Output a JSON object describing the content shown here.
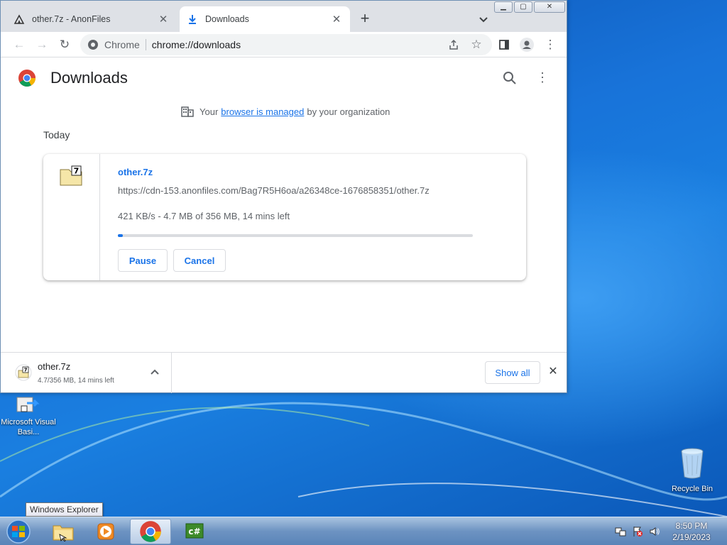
{
  "browser": {
    "tabs": [
      {
        "title": "other.7z - AnonFiles",
        "icon": "anonfiles-icon",
        "active": false
      },
      {
        "title": "Downloads",
        "icon": "download-icon",
        "active": true
      }
    ],
    "omnibox": {
      "site": "Chrome",
      "url": "chrome://downloads"
    }
  },
  "page": {
    "title": "Downloads",
    "managed": {
      "prefix": "Your",
      "link": "browser is managed",
      "suffix": "by your organization"
    },
    "section": "Today",
    "download": {
      "name": "other.7z",
      "url": "https://cdn-153.anonfiles.com/Bag7R5H6oa/a26348ce-1676858351/other.7z",
      "status": "421 KB/s - 4.7 MB of 356 MB, 14 mins left",
      "progress_fraction": 0.013,
      "pause_label": "Pause",
      "cancel_label": "Cancel"
    }
  },
  "shelf": {
    "name": "other.7z",
    "sub": "4.7/356 MB, 14 mins left",
    "show_all_label": "Show all"
  },
  "desktop": {
    "icons": [
      {
        "label": "Microsoft Visual Basi...",
        "icon": "visual-basic-icon"
      },
      {
        "label": "Recycle Bin",
        "icon": "recycle-bin-icon"
      }
    ]
  },
  "taskbar": {
    "tooltip": "Windows Explorer",
    "time": "8:50 PM",
    "date": "2/19/2023"
  },
  "colors": {
    "accent": "#1a73e8",
    "desktop": "#1873d9",
    "tabstrip": "#dee1e6"
  }
}
